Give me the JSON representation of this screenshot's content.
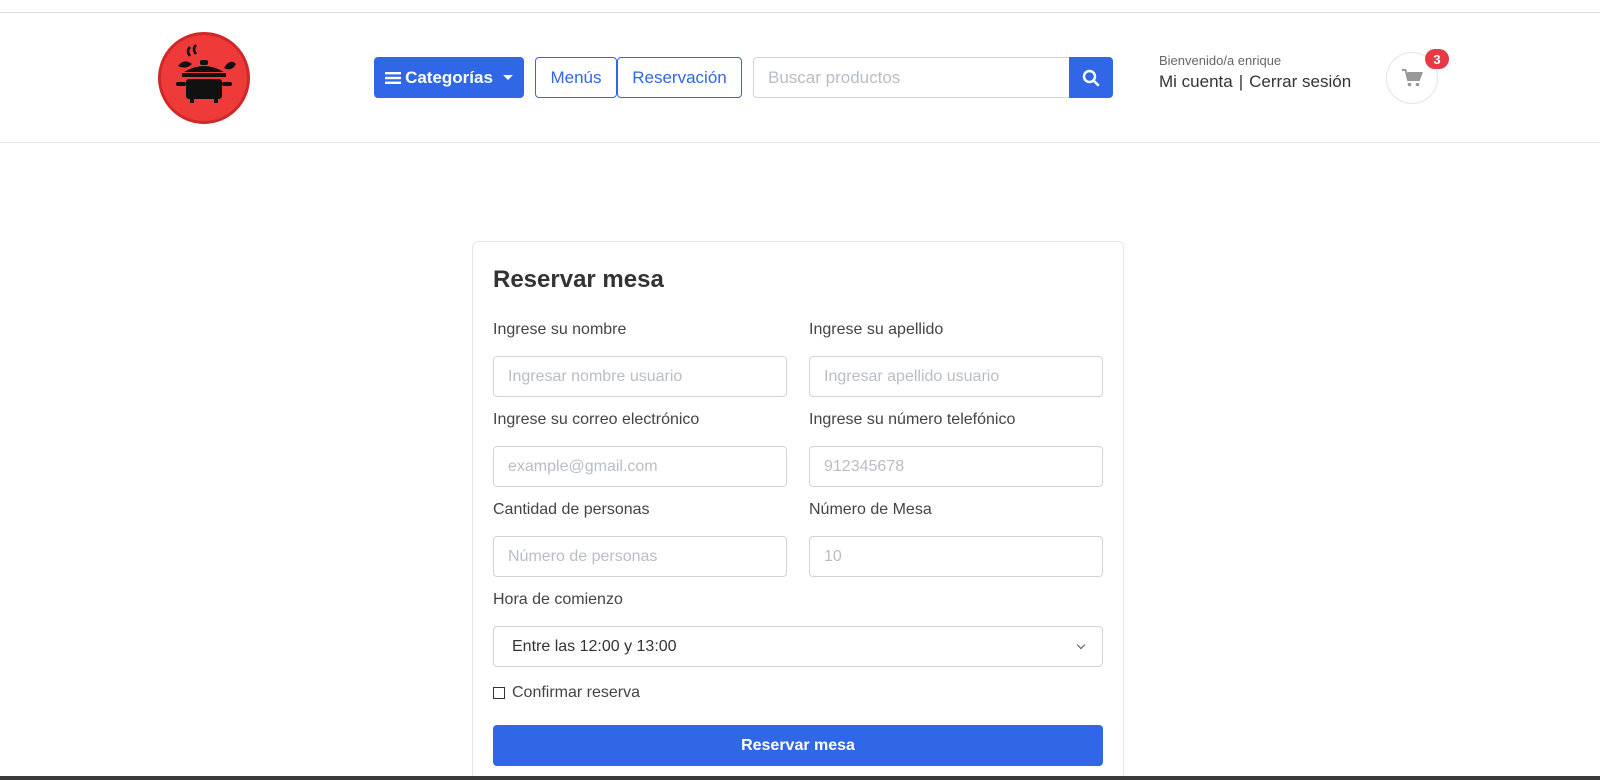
{
  "header": {
    "categories_label": "Categorías",
    "menus_label": "Menús",
    "reservation_label": "Reservación",
    "search": {
      "placeholder": "Buscar productos",
      "value": ""
    },
    "welcome_text": "Bienvenido/a enrique",
    "my_account": "Mi cuenta",
    "separator": "|",
    "logout": "Cerrar sesión",
    "cart_count": "3"
  },
  "form": {
    "title": "Reservar mesa",
    "nombre": {
      "label": "Ingrese su nombre",
      "placeholder": "Ingresar nombre usuario"
    },
    "apellido": {
      "label": "Ingrese su apellido",
      "placeholder": "Ingresar apellido usuario"
    },
    "correo": {
      "label": "Ingrese su correo electrónico",
      "placeholder": "example@gmail.com"
    },
    "telefono": {
      "label": "Ingrese su número telefónico",
      "placeholder": "912345678"
    },
    "personas": {
      "label": "Cantidad de personas",
      "placeholder": "Número de personas"
    },
    "mesa": {
      "label": "Número de Mesa",
      "placeholder": "10"
    },
    "hora": {
      "label": "Hora de comienzo",
      "selected": "Entre las 12:00 y 13:00"
    },
    "confirm_label": "Confirmar reserva",
    "submit_label": "Reservar mesa"
  },
  "colors": {
    "primary": "#2f67e7",
    "logo_red": "#ef3a3a",
    "badge_red": "#e63946"
  },
  "icons": {
    "menu": "hamburger-icon",
    "search": "search-icon",
    "cart": "cart-icon",
    "logo": "cooking-pot-icon"
  }
}
